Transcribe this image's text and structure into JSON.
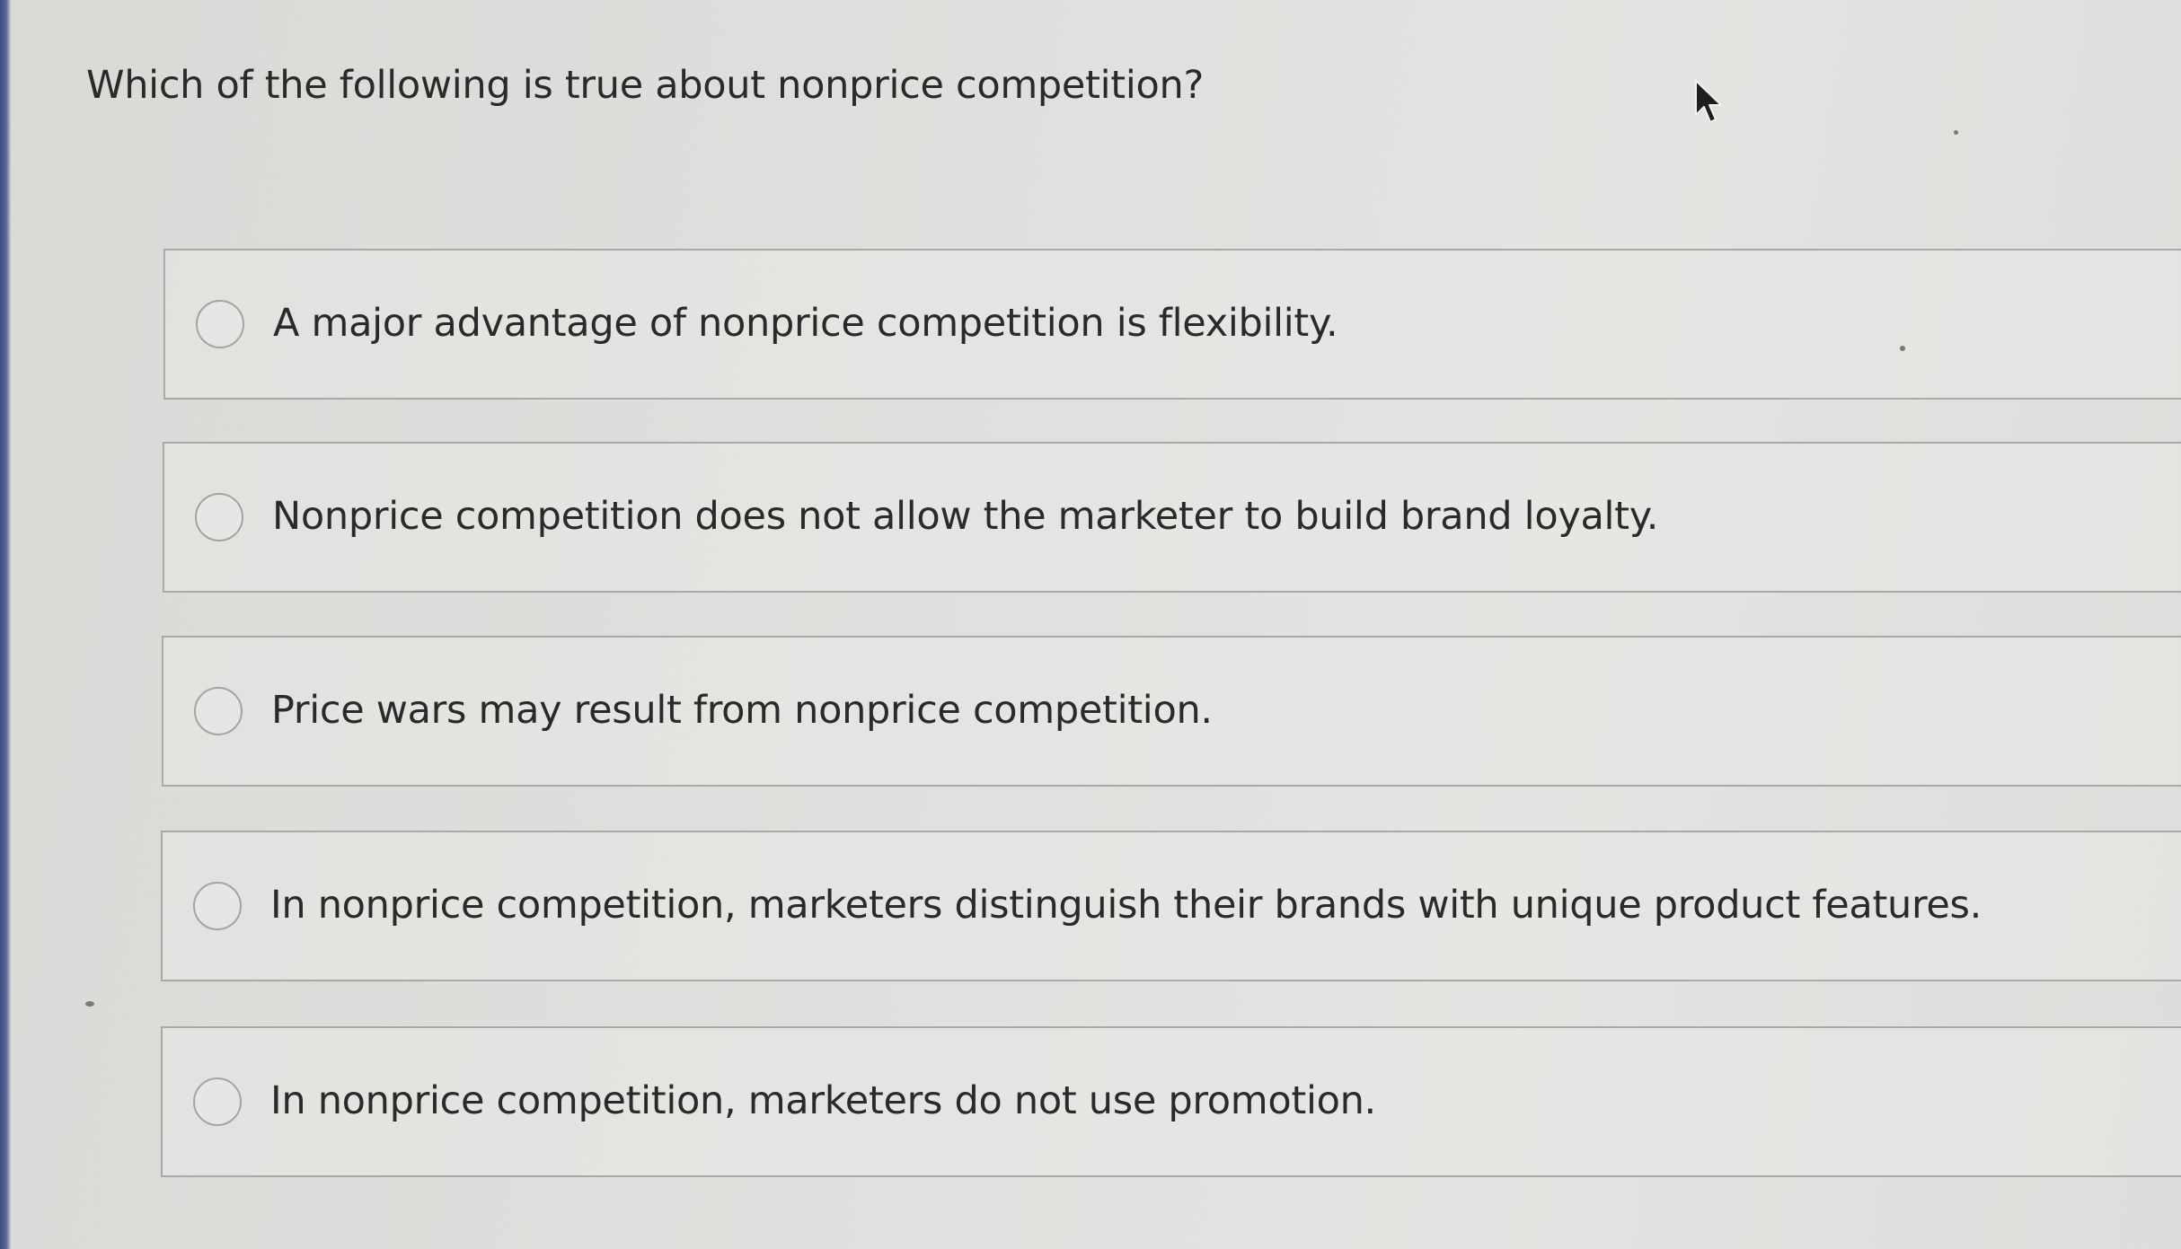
{
  "question": {
    "text": "Which of the following is true about nonprice competition?"
  },
  "options": [
    {
      "label": "A major advantage of nonprice competition is flexibility.",
      "selected": false
    },
    {
      "label": "Nonprice competition does not allow the marketer to build brand loyalty.",
      "selected": false
    },
    {
      "label": "Price wars may result from nonprice competition.",
      "selected": false
    },
    {
      "label": "In nonprice competition, marketers distinguish their brands with unique product features.",
      "selected": false
    },
    {
      "label": "In nonprice competition, marketers do not use promotion.",
      "selected": false
    }
  ],
  "icons": {
    "radio": "radio-unselected-icon",
    "cursor": "mouse-pointer-icon"
  },
  "colors": {
    "background": "#dedfdc",
    "border": "#a9aaa8",
    "text": "#2a2a2a",
    "left_edge": "#3a4a7a"
  }
}
